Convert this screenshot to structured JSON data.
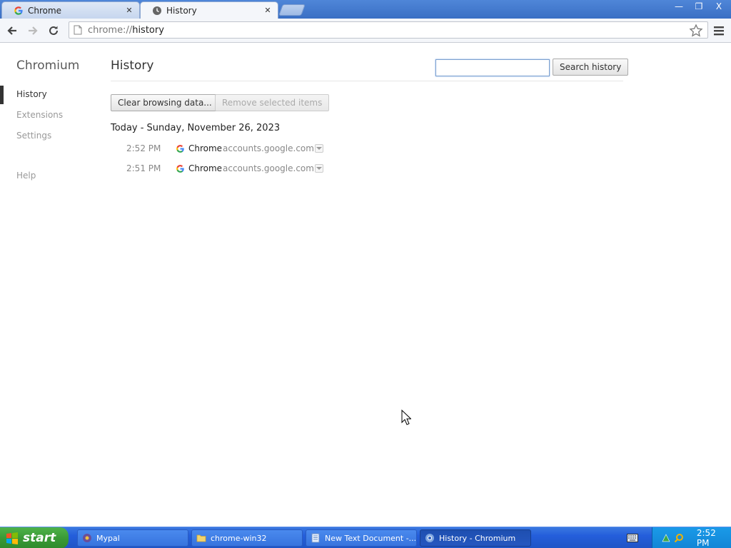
{
  "window": {
    "tabs": [
      {
        "label": "Chrome",
        "icon": "google-g-icon",
        "active": false
      },
      {
        "label": "History",
        "icon": "clock-icon",
        "active": true
      }
    ],
    "close_glyph": "✕",
    "controls": {
      "minimize": "—",
      "restore": "❐",
      "close": "X"
    }
  },
  "toolbar": {
    "url_scheme": "chrome://",
    "url_path": "history"
  },
  "sidebar": {
    "brand": "Chromium",
    "items": [
      {
        "label": "History",
        "selected": true
      },
      {
        "label": "Extensions",
        "selected": false
      },
      {
        "label": "Settings",
        "selected": false
      },
      {
        "label": "Help",
        "selected": false
      }
    ]
  },
  "main": {
    "title": "History",
    "search_button": "Search history",
    "search_value": "",
    "clear_button": "Clear browsing data...",
    "remove_button": "Remove selected items",
    "day_header": "Today - Sunday, November 26, 2023",
    "entries": [
      {
        "time": "2:52 PM",
        "title": "Chrome",
        "domain": "accounts.google.com"
      },
      {
        "time": "2:51 PM",
        "title": "Chrome",
        "domain": "accounts.google.com"
      }
    ]
  },
  "taskbar": {
    "start_label": "start",
    "tasks": [
      {
        "label": "Mypal",
        "active": false
      },
      {
        "label": "chrome-win32",
        "active": false
      },
      {
        "label": "New Text Document -...",
        "active": false
      },
      {
        "label": "History - Chromium",
        "active": true
      }
    ],
    "clock": "2:52 PM"
  },
  "colors": {
    "accent_blue": "#245edb",
    "start_green": "#3a9a36",
    "google_blue": "#4285f4",
    "google_red": "#ea4335",
    "google_yellow": "#fbbc05",
    "google_green": "#34a853"
  }
}
